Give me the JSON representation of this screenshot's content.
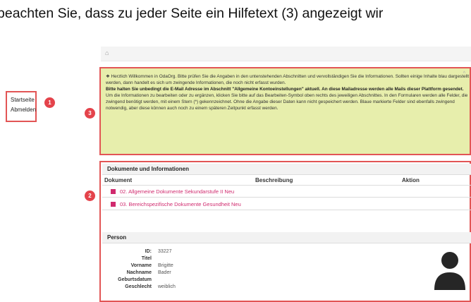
{
  "caption": "beachten Sie, dass zu jeder Seite ein Hilfetext (3) angezeigt wir",
  "sidebar": {
    "items": [
      {
        "label": "Startseite"
      },
      {
        "label": "Abmelden"
      }
    ]
  },
  "badges": {
    "one": "1",
    "two": "2",
    "three": "3"
  },
  "breadcrumb": {
    "icon": "home-icon"
  },
  "help": {
    "intro": "Herzlich Willkommen in OdaOrg. Bitte prüfen Sie die Angaben in den untenstehenden Abschnitten und vervollständigen Sie die Informationen. Sollten einige Inhalte blau dargestellt werden, dann handelt es sich um zwingende Informationen, die noch nicht erfasst wurden.",
    "important": "Bitte halten Sie unbedingt die E-Mail Adresse im Abschnitt \"Allgemeine Kontoeinstellungen\" aktuell. An diese Mailadresse werden alle Mails dieser Plattform gesendet.",
    "details": "Um die Informationen zu bearbeiten oder zu ergänzen, klicken Sie bitte auf das Bearbeiten-Symbol oben rechts des jeweiligen Abschnittes. In den Formularen werden alle Felder, die zwingend benötigt werden, mit einem Stern (*) gekennzeichnet. Ohne die Angabe dieser Daten kann nicht gespeichert werden. Blaue markierte Felder sind ebenfalls zwingend notwendig, aber diese können auch noch zu einem späteren Zeitpunkt erfasst werden."
  },
  "documents": {
    "title": "Dokumente und Informationen",
    "columns": {
      "document": "Dokument",
      "description": "Beschreibung",
      "action": "Aktion"
    },
    "rows": [
      {
        "label": "02. Allgemeine Dokumente Sekundarstufe II Neu"
      },
      {
        "label": "03. Bereichspezifische Dokumente Gesundheit Neu"
      }
    ]
  },
  "person": {
    "title": "Person",
    "fields": [
      {
        "key": "ID:",
        "value": "33227"
      },
      {
        "key": "Titel",
        "value": ""
      },
      {
        "key": "Vorname",
        "value": "Brigitte"
      },
      {
        "key": "Nachname",
        "value": "Bader"
      },
      {
        "key": "Geburtsdatum",
        "value": ""
      },
      {
        "key": "Geschlecht",
        "value": "weiblich"
      }
    ],
    "avatar_icon": "user-avatar-icon"
  },
  "colors": {
    "highlight": "#e25555",
    "help_bg": "#e7eeac",
    "link": "#d02a6e",
    "badge": "#e4434b"
  }
}
